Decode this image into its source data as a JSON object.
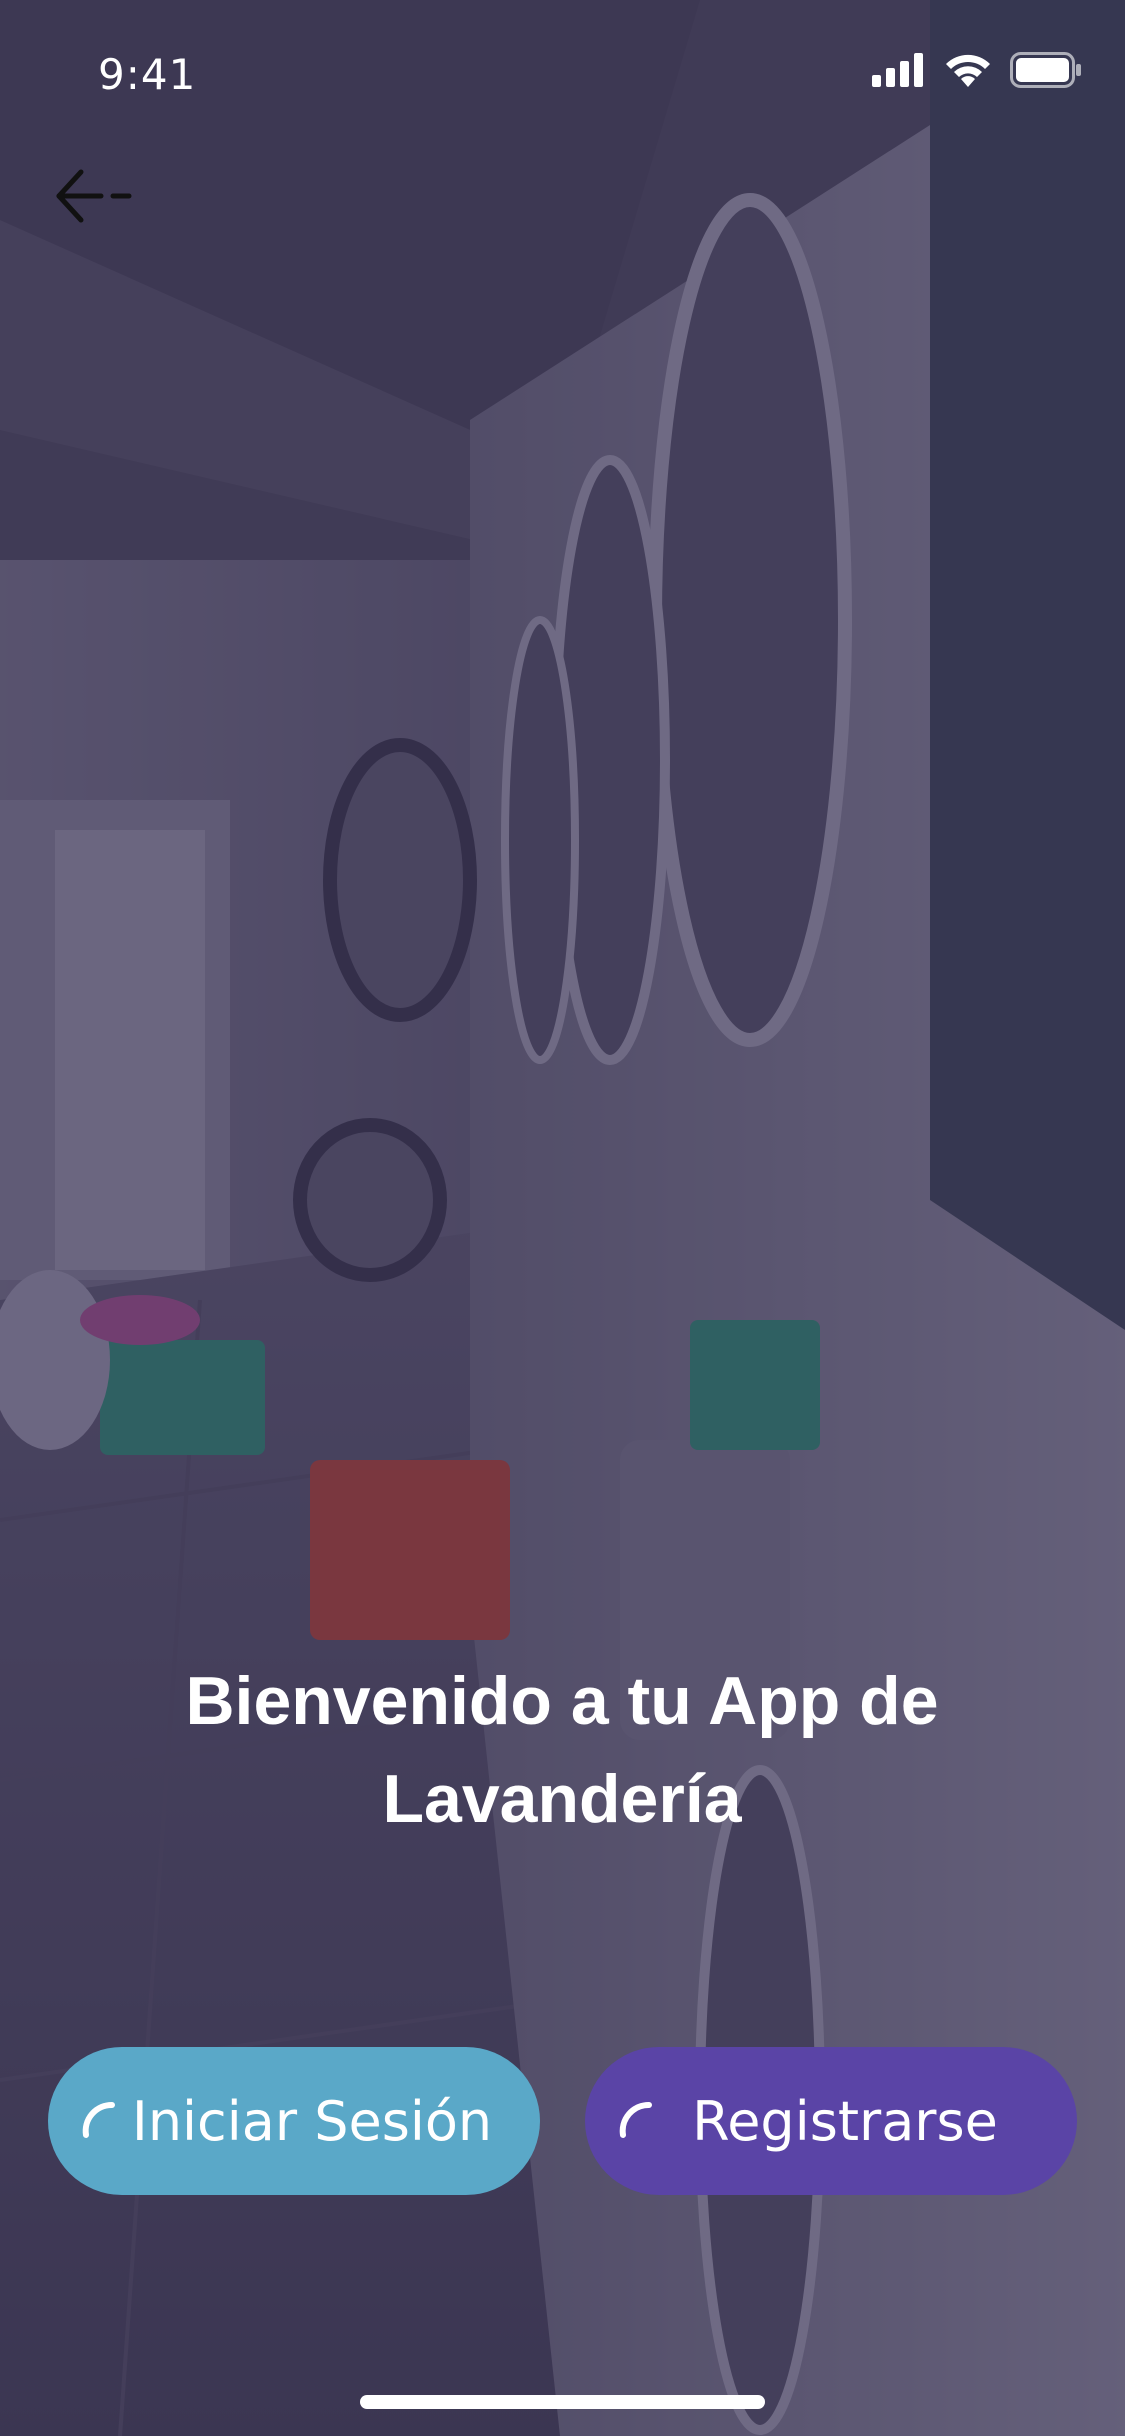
{
  "status_bar": {
    "time": "9:41"
  },
  "icons": {
    "back": "arrow-left-icon",
    "signal": "cellular-signal-icon",
    "wifi": "wifi-icon",
    "battery": "battery-icon",
    "spinner": "loading-spinner-icon"
  },
  "welcome": {
    "title_line1": "Bienvenido a tu App de",
    "title_line2": "Lavandería"
  },
  "buttons": {
    "login_label": "Iniciar Sesión",
    "register_label": "Registrarse"
  },
  "colors": {
    "login_button": "#5aa8c8",
    "register_button": "#5a44a6",
    "overlay": "#30284e",
    "text": "#ffffff"
  }
}
